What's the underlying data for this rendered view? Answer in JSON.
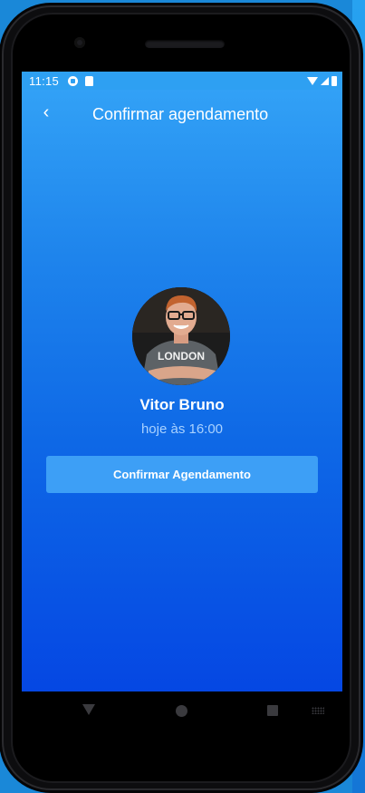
{
  "status_bar": {
    "time": "11:15",
    "icons": [
      "notification-icon",
      "sd-card-icon",
      "wifi-icon",
      "signal-icon",
      "battery-icon"
    ]
  },
  "header": {
    "back_icon": "chevron-left-icon",
    "back_glyph": "‹",
    "title": "Confirmar agendamento"
  },
  "appointment": {
    "provider_name": "Vitor Bruno",
    "time_text": "hoje às 16:00",
    "shirt_text": "LONDON"
  },
  "actions": {
    "confirm_label": "Confirmar Agendamento"
  },
  "colors": {
    "gradient_top": "#34a4f7",
    "gradient_bottom": "#0547e3",
    "button": "#3d9ff6",
    "subtitle": "#a9d2ff"
  },
  "nav": {
    "icons": [
      "nav-back-icon",
      "nav-home-icon",
      "nav-recents-icon",
      "keyboard-icon"
    ]
  }
}
